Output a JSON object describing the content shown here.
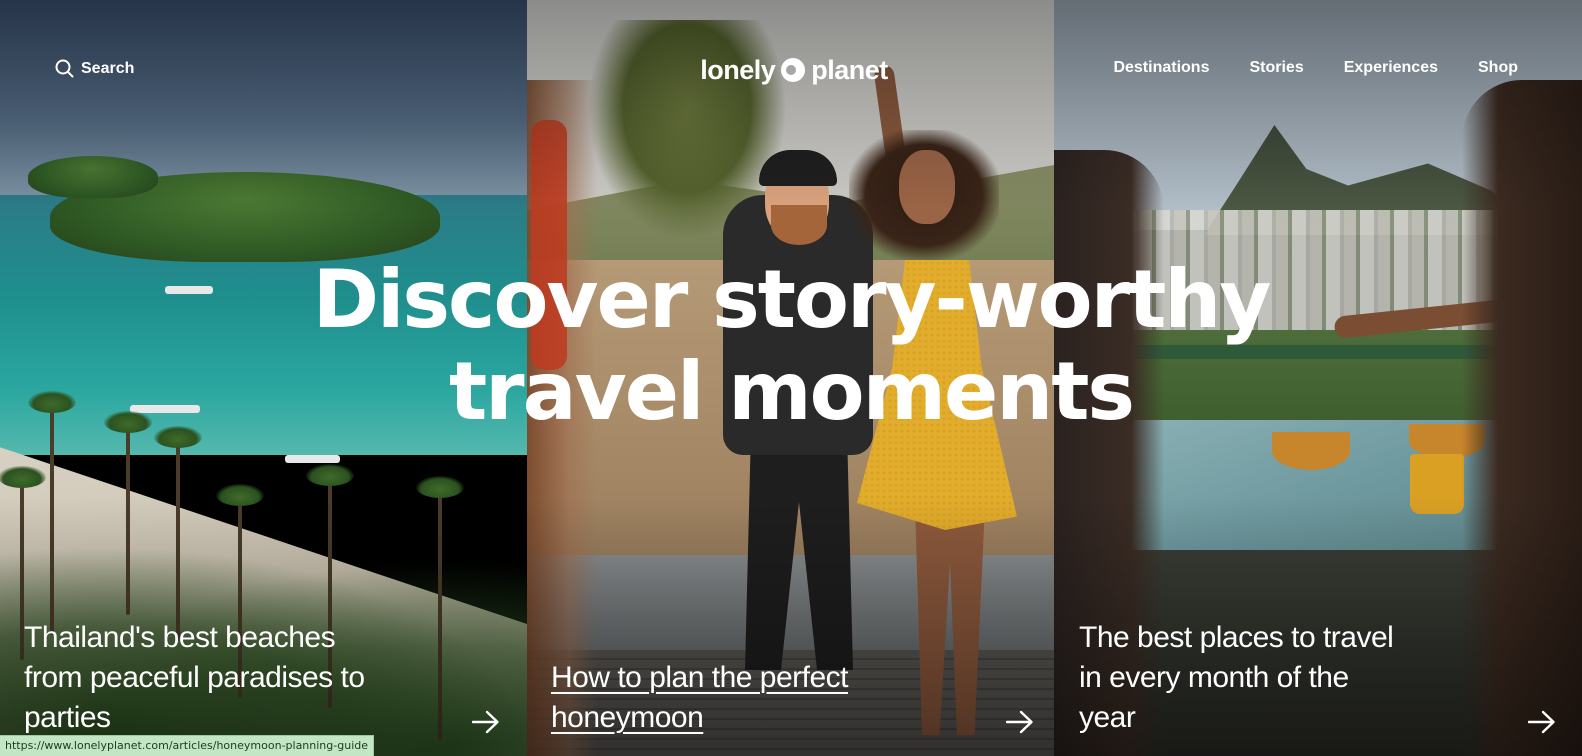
{
  "header": {
    "search_label": "Search",
    "logo_text_left": "lonely",
    "logo_text_right": "planet",
    "nav": {
      "destinations": "Destinations",
      "stories": "Stories",
      "experiences": "Experiences",
      "shop": "Shop"
    }
  },
  "hero": {
    "headline_line1": "Discover story-worthy",
    "headline_line2": "travel moments"
  },
  "cards": [
    {
      "title": "Thailand's best beaches from peaceful paradises to parties",
      "icon": "arrow-right-icon"
    },
    {
      "title": "How to plan the perfect honeymoon",
      "icon": "arrow-right-icon",
      "hovered": true
    },
    {
      "title": "The best places to travel in every month of the year",
      "icon": "arrow-right-icon"
    }
  ],
  "status_bar": {
    "url": "https://www.lonelyplanet.com/articles/honeymoon-planning-guide"
  },
  "colors": {
    "text": "#ffffff",
    "status_bar_bg": "#c3e7c4"
  }
}
